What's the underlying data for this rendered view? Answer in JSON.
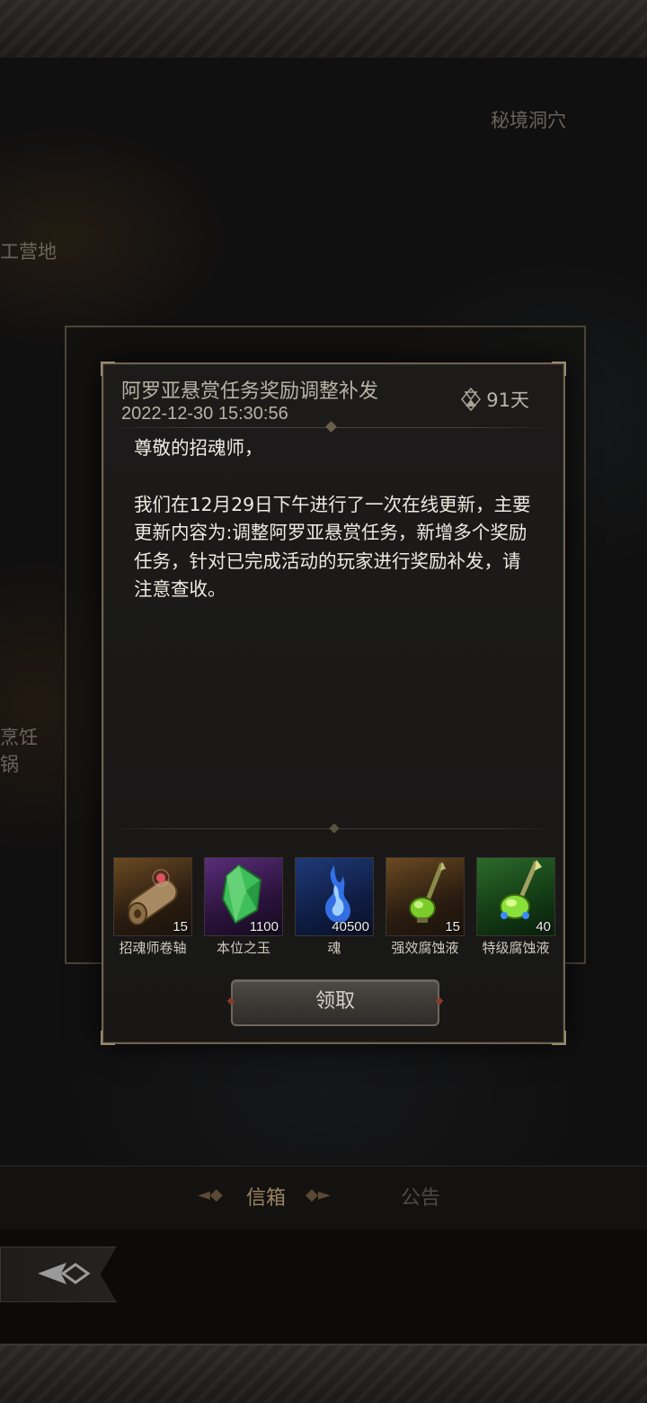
{
  "background": {
    "location_labels": [
      "秘境洞穴",
      "工营地",
      "烹饪锅"
    ],
    "tabs": [
      {
        "label": "信箱",
        "active": true
      },
      {
        "label": "公告",
        "active": false
      }
    ],
    "back_icon": "back-arrow-icon"
  },
  "mail": {
    "title": "阿罗亚悬赏任务奖励调整补发",
    "date": "2022-12-30 15:30:56",
    "expire_icon": "hourglass-icon",
    "expire": "91天",
    "greeting": "尊敬的招魂师，",
    "body": "我们在12月29日下午进行了一次在线更新，主要更新内容为:调整阿罗亚悬赏任务，新增多个奖励任务，针对已完成活动的玩家进行奖励补发，请注意查收。",
    "items": [
      {
        "name": "招魂师卷轴",
        "count": "15",
        "icon": "scroll-icon",
        "rarity_color": "#6b4a22"
      },
      {
        "name": "本位之玉",
        "count": "1100",
        "icon": "green-crystal-icon",
        "rarity_color": "#5a2d7a"
      },
      {
        "name": "魂",
        "count": "40500",
        "icon": "blue-soul-flame-icon",
        "rarity_color": "#1f3a78"
      },
      {
        "name": "强效腐蚀液",
        "count": "15",
        "icon": "potion-staff-icon",
        "rarity_color": "#6b4a22"
      },
      {
        "name": "特级腐蚀液",
        "count": "40",
        "icon": "potion-staff-icon",
        "rarity_color": "#2c6a2a"
      }
    ],
    "claim_label": "领取"
  },
  "colors": {
    "accent_gold": "#9a8a6a",
    "text_primary": "#efeae2",
    "text_secondary": "#b9b2a6"
  }
}
